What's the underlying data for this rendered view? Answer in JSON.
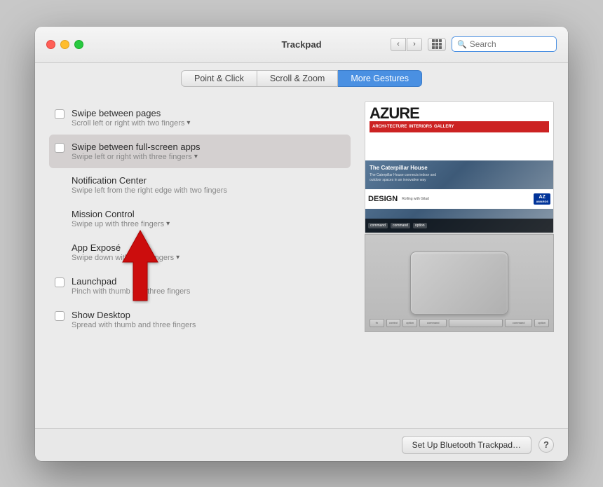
{
  "window": {
    "title": "Trackpad",
    "traffic_lights": {
      "close": "close",
      "minimize": "minimize",
      "maximize": "maximize"
    }
  },
  "search": {
    "placeholder": "Search"
  },
  "tabs": [
    {
      "id": "point-click",
      "label": "Point & Click",
      "active": false
    },
    {
      "id": "scroll-zoom",
      "label": "Scroll & Zoom",
      "active": false
    },
    {
      "id": "more-gestures",
      "label": "More Gestures",
      "active": true
    }
  ],
  "settings": [
    {
      "id": "swipe-between-pages",
      "title": "Swipe between pages",
      "subtitle": "Scroll left or right with two fingers",
      "has_checkbox": true,
      "checked": false,
      "has_dropdown": true,
      "highlighted": false
    },
    {
      "id": "swipe-between-apps",
      "title": "Swipe between full-screen apps",
      "subtitle": "Swipe left or right with three fingers",
      "has_checkbox": true,
      "checked": false,
      "has_dropdown": true,
      "highlighted": true
    },
    {
      "id": "notification-center",
      "title": "Notification Center",
      "subtitle": "Swipe left from the right edge with two fingers",
      "has_checkbox": false,
      "checked": false,
      "has_dropdown": false,
      "highlighted": false
    },
    {
      "id": "mission-control",
      "title": "Mission Control",
      "subtitle": "Swipe up with three fingers",
      "has_checkbox": false,
      "checked": false,
      "has_dropdown": true,
      "highlighted": false
    },
    {
      "id": "app-expose",
      "title": "App Exposé",
      "subtitle": "Swipe down with three fingers",
      "has_checkbox": false,
      "checked": false,
      "has_dropdown": true,
      "highlighted": false
    },
    {
      "id": "launchpad",
      "title": "Launchpad",
      "subtitle": "Pinch with thumb and three fingers",
      "has_checkbox": true,
      "checked": false,
      "has_dropdown": false,
      "highlighted": false
    },
    {
      "id": "show-desktop",
      "title": "Show Desktop",
      "subtitle": "Spread with thumb and three fingers",
      "has_checkbox": true,
      "checked": false,
      "has_dropdown": false,
      "highlighted": false
    }
  ],
  "bottom_bar": {
    "bluetooth_button": "Set Up Bluetooth Trackpad…",
    "help_label": "?"
  },
  "preview": {
    "azure_logo": "AZURE",
    "caterpillar_text": "The Caterpillar House",
    "design_text": "DESIGN",
    "rolling_text": "Rolling with Gilad",
    "az_badge": "AZ",
    "awards_text": "AWARDS",
    "command_key": "command",
    "option_key": "option"
  }
}
